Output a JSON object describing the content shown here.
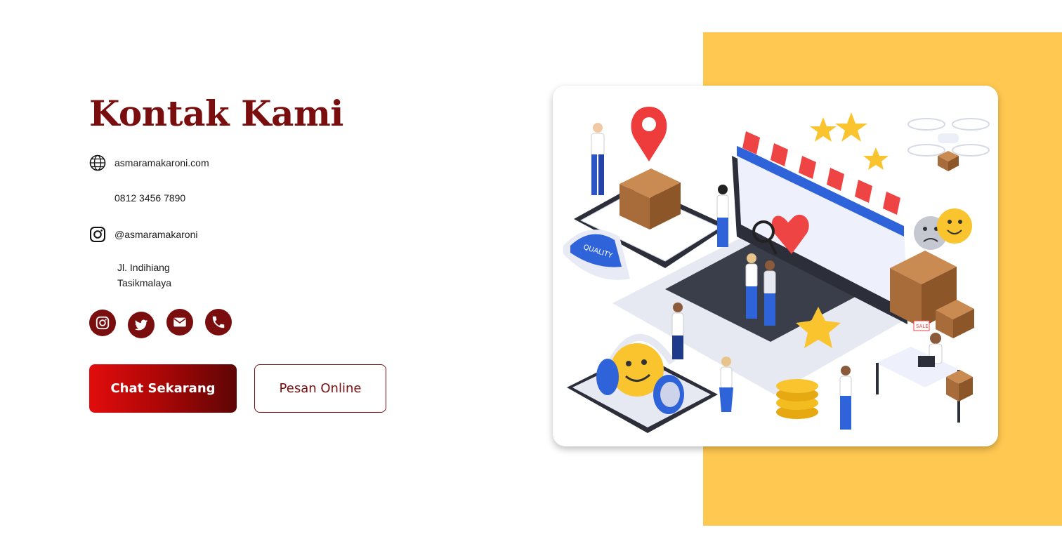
{
  "title": "Kontak Kami",
  "contacts": {
    "website": "asmaramakaroni.com",
    "phone": "0812 3456 7890",
    "instagram": "@asmaramakaroni",
    "address_line1": "Jl. Indihiang",
    "address_line2": "Tasikmalaya"
  },
  "social_icons": [
    "instagram-icon",
    "twitter-icon",
    "mail-icon",
    "phone-icon"
  ],
  "buttons": {
    "chat": "Chat Sekarang",
    "order": "Pesan Online"
  },
  "illustration": {
    "quality_label": "QUALITY",
    "sale_label": "SALE"
  },
  "colors": {
    "brand": "#7A0E0E",
    "accent_yellow": "#FFC851",
    "button_gradient_start": "#E20C0C",
    "button_gradient_end": "#5E0505"
  }
}
